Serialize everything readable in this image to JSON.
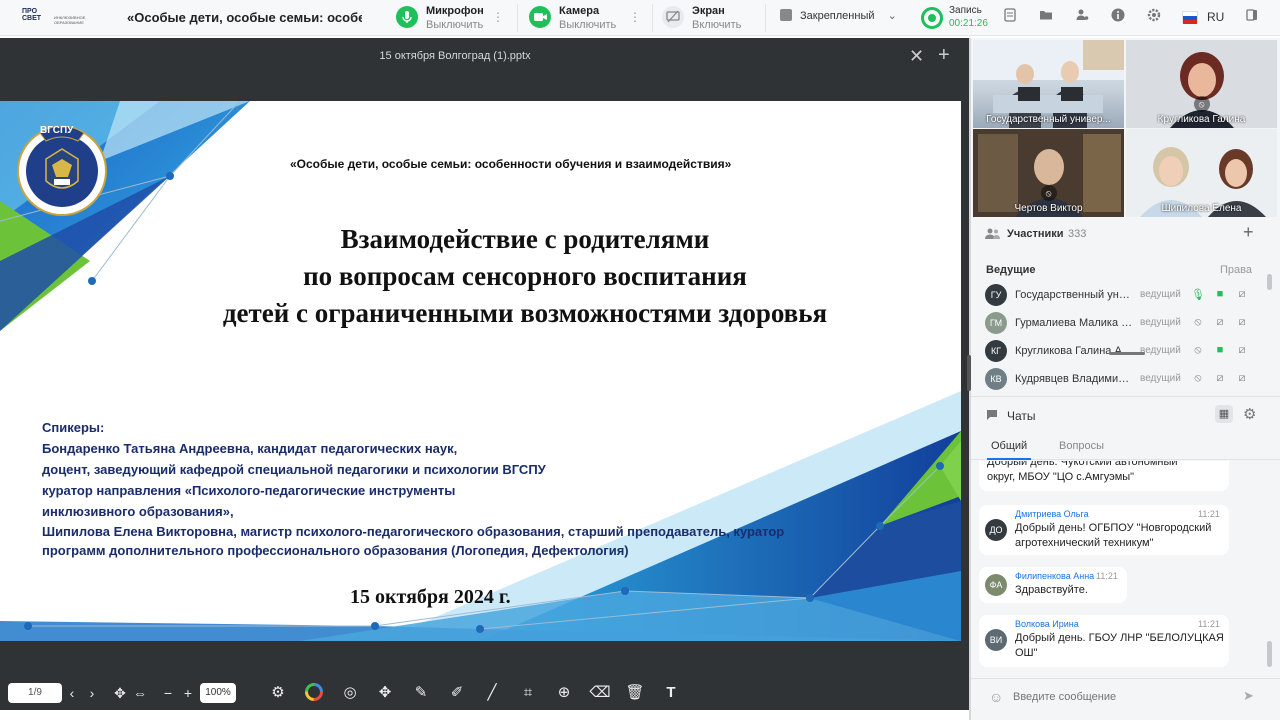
{
  "header": {
    "logo_line1": "ПРО СВЕТ",
    "logo_line2": "ИНКЛЮЗИВНОЕ ОБРАЗОВАНИЕ",
    "conference_title": "«Особые дети, особые семьи: особенн...",
    "mic": {
      "label": "Микрофон",
      "action": "Выключить"
    },
    "camera": {
      "label": "Камера",
      "action": "Выключить"
    },
    "screen": {
      "label": "Экран",
      "action": "Включить"
    },
    "pinned": "Закрепленный",
    "recording": {
      "label": "Запись",
      "time": "00:21:26"
    },
    "language": "RU"
  },
  "viewer": {
    "file_name": "15 октября Волгоград (1).pptx",
    "page": "1/9",
    "zoom": "100%"
  },
  "slide": {
    "top_line": "«Особые дети, особые семьи: особенности обучения и взаимодействия»",
    "title_lines": [
      "Взаимодействие с родителями",
      "по вопросам сенсорного воспитания",
      "детей с ограниченными возможностями здоровья"
    ],
    "speakers_label": "Спикеры:",
    "speakers_lines": [
      "Бондаренко Татьяна Андреевна, кандидат педагогических наук,",
      "доцент, заведующий кафедрой специальной педагогики и психологии ВГСПУ",
      "куратор направления «Психолого-педагогические инструменты",
      "инклюзивного образования»,",
      "Шипилова Елена Викторовна, магистр психолого-педагогического образования, старший преподаватель, куратор",
      "программ дополнительного профессионального образования (Логопедия, Дефектология)"
    ],
    "date": "15 октября 2024 г.",
    "emblem_text": "ВГСПУ"
  },
  "videos": [
    {
      "name": "Государственный универ..."
    },
    {
      "name": "Кругликова Галина"
    },
    {
      "name": "Чертов Виктор"
    },
    {
      "name": "Шипилова Елена"
    }
  ],
  "participants": {
    "title": "Участники",
    "count": "333",
    "hosts_label": "Ведущие",
    "rights_label": "Права",
    "list": [
      {
        "initials": "ГУ",
        "name": "Государственный уни...",
        "role": "ведущий",
        "color": "#333a40"
      },
      {
        "initials": "ГМ",
        "name": "Гурмалиева Малика З...",
        "role": "ведущий",
        "color": "#8a9a8c"
      },
      {
        "initials": "КГ",
        "name": "Кругликова Галина Ал...",
        "role": "ведущий",
        "color": "#333a40"
      },
      {
        "initials": "КВ",
        "name": "Кудрявцев Владимир ...",
        "role": "ведущий",
        "color": "#6f7f86"
      }
    ]
  },
  "chats": {
    "title": "Чаты",
    "tabs": [
      "Общий",
      "Вопросы"
    ],
    "messages": [
      {
        "initials": "",
        "author": "",
        "time": "",
        "lines": [
          "Добрый день. Чукотский автономный",
          "округ, МБОУ \"ЦО с.Амгуэмы\""
        ]
      },
      {
        "initials": "ДО",
        "author": "Дмитриева Ольга",
        "time": "11:21",
        "lines": [
          "Добрый день! ОГБПОУ \"Новгородский",
          "агротехнический техникум\""
        ],
        "color": "#333a40"
      },
      {
        "initials": "ФА",
        "author": "Филипенкова Анна",
        "time": "11:21",
        "lines": [
          "Здравствуйте."
        ],
        "color": "#7c8a6e"
      },
      {
        "initials": "ВИ",
        "author": "Волкова Ирина",
        "time": "11:21",
        "lines": [
          "Добрый день. ГБОУ ЛНР \"БЕЛОЛУЦКАЯ",
          "ОШ\""
        ],
        "color": "#5d6a72"
      }
    ],
    "input_placeholder": "Введите сообщение"
  }
}
